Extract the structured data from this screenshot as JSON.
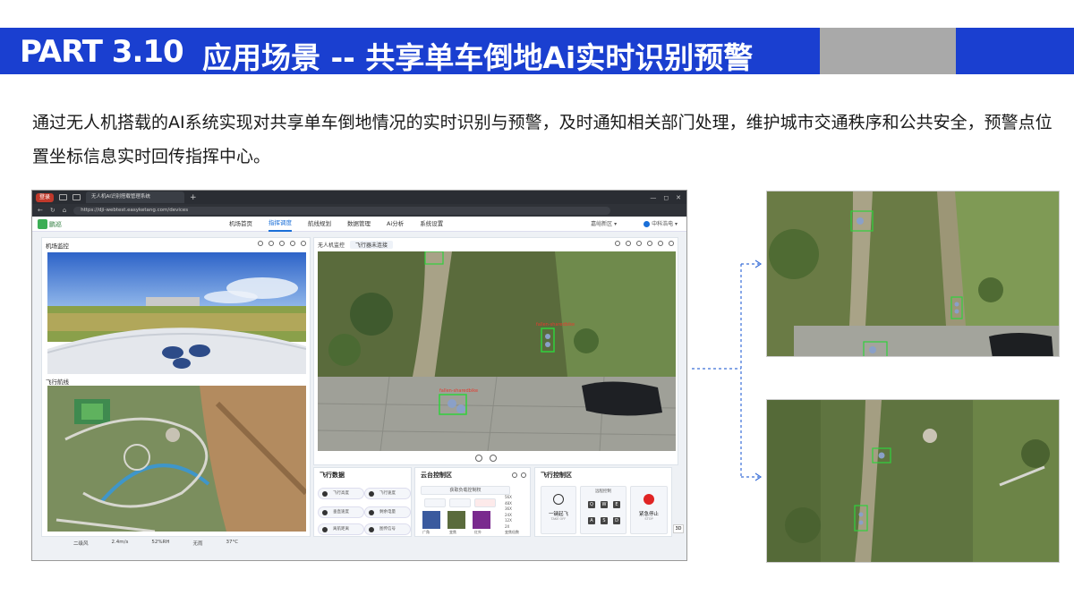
{
  "header": {
    "part_label": "PART  3.10",
    "title": "应用场景 -- 共享单车倒地Ai实时识别预警"
  },
  "description": "通过无人机搭载的AI系统实现对共享单车倒地情况的实时识别与预警，及时通知相关部门处理，维护城市交通秩序和公共安全，预警点位置坐标信息实时回传指挥中心。",
  "browser": {
    "tab_pill": "登录",
    "active_tab": "无人机AI识别搭载管理系统",
    "new_tab": "+",
    "window_controls": [
      "—",
      "◻",
      "✕"
    ],
    "url": "https://dji-webtest.easyketang.com/devices",
    "app": {
      "logo_text": "鹏巡",
      "menu": [
        "机场首页",
        "指挥调度",
        "航线规划",
        "数据管理",
        "Ai分析",
        "系统设置"
      ],
      "active_menu_index": 1,
      "region": "嘉峪新区 ▾",
      "user": "中科浩电 ▾"
    },
    "left_panel": {
      "title": "机场监控",
      "route_title": "飞行航线"
    },
    "center_panel": {
      "tab1": "无人机监控",
      "tab2": "飞行器未连接"
    },
    "status_items": [
      "二级风",
      "2.4m/s",
      "52%RH",
      "无雨",
      "37°C"
    ],
    "flight_data": {
      "title": "飞行数据",
      "chips": [
        "飞行高度",
        "飞行速度",
        "垂直速度",
        "剩余电量",
        "离航距离",
        "图传信号"
      ]
    },
    "gimbal": {
      "title": "云台控制区",
      "button": "获取负载控制权",
      "zoom_levels": [
        "56X",
        "48X",
        "36X",
        "24X",
        "12X",
        "2X"
      ],
      "zoom_label": "变焦倍数",
      "thumbs": [
        "广角",
        "变焦",
        "红外"
      ]
    },
    "flight_control": {
      "title": "飞行控制区",
      "takeoff": "一键起飞",
      "takeoff_en": "TAKE OFF",
      "remote_label": "远程控制",
      "keys": [
        "Q",
        "W",
        "E",
        "A",
        "S",
        "D"
      ],
      "stop": "紧急停止",
      "stop_en": "STOP"
    },
    "view_3d": "3D"
  },
  "detection_label": "fallen-sharedbike"
}
